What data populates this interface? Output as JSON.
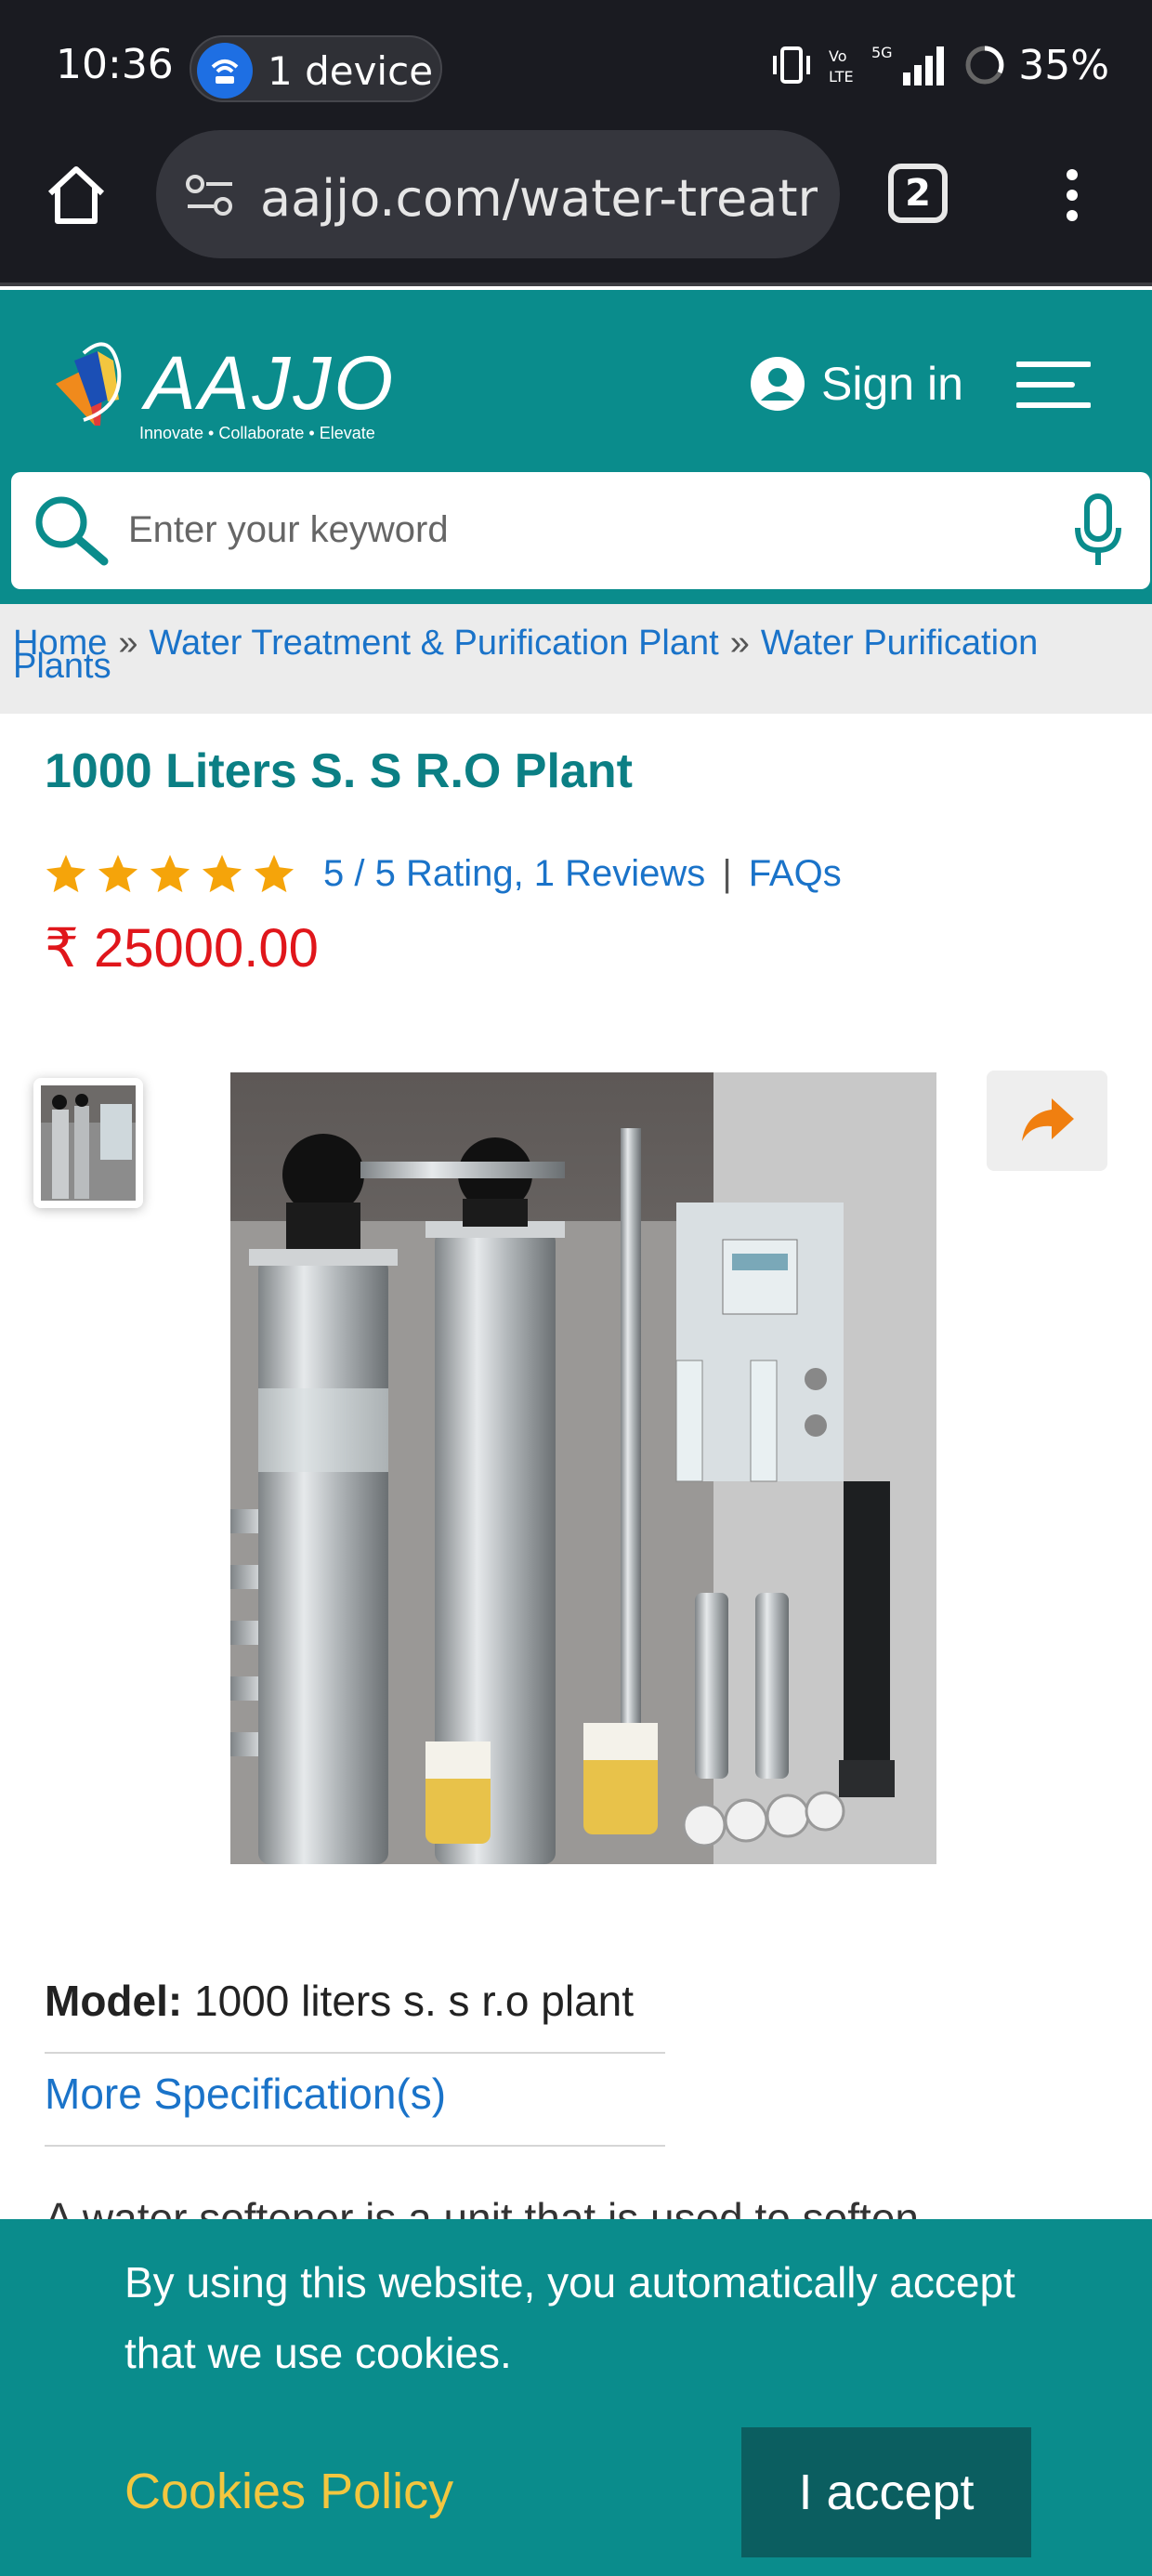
{
  "status_bar": {
    "time": "10:36",
    "device_pill": "1 device",
    "network": "5G",
    "battery": "35%"
  },
  "browser": {
    "url": "aajjo.com/water-treatme",
    "tab_count": "2"
  },
  "site": {
    "logo_text": "AAJJO",
    "logo_tagline": "Innovate • Collaborate • Elevate",
    "signin_label": "Sign in",
    "search_placeholder": "Enter your keyword",
    "brand_color": "#0a8c8c"
  },
  "breadcrumb": {
    "items": [
      "Home",
      "Water Treatment & Purification Plant",
      "Water Purification"
    ],
    "last_line": "Plants"
  },
  "product": {
    "title": "1000 Liters S. S R.O Plant",
    "rating_text": "5 / 5 Rating, 1 Reviews",
    "rating_value": 5,
    "rating_max": 5,
    "faqs_label": "FAQs",
    "price": "₹ 25000.00",
    "model_label": "Model:",
    "model_value": "1000 liters s. s r.o plant",
    "more_spec_label": "More Specification(s)",
    "description_start": "A water softener is a unit that is used to soften"
  },
  "cookie_banner": {
    "message": "By using this website, you automatically accept that we use cookies.",
    "policy_label": "Cookies Policy",
    "accept_label": "I accept"
  }
}
